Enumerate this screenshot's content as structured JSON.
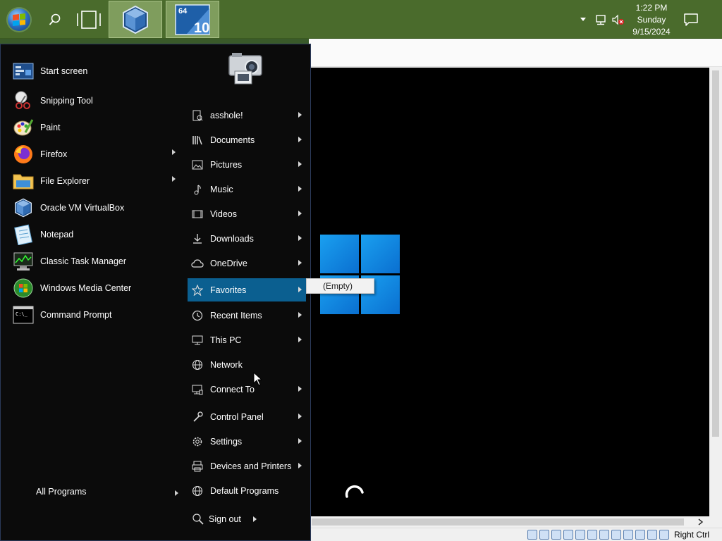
{
  "taskbar": {
    "clock": {
      "time": "1:22 PM",
      "day": "Sunday",
      "date": "9/15/2024"
    },
    "apps": [
      {
        "icon": "virtualbox-icon"
      },
      {
        "icon": "windows10-vm-icon",
        "badge_top": "64",
        "badge_num": "10"
      }
    ]
  },
  "start_menu": {
    "programs": [
      {
        "label": "Start screen",
        "icon": "start-screen-icon",
        "has_submenu": false
      },
      {
        "label": "Snipping Tool",
        "icon": "snipping-tool-icon",
        "has_submenu": false
      },
      {
        "label": "Paint",
        "icon": "paint-icon",
        "has_submenu": false
      },
      {
        "label": "Firefox",
        "icon": "firefox-icon",
        "has_submenu": true
      },
      {
        "label": "File Explorer",
        "icon": "file-explorer-icon",
        "has_submenu": true
      },
      {
        "label": "Oracle VM VirtualBox",
        "icon": "virtualbox-icon",
        "has_submenu": false
      },
      {
        "label": "Notepad",
        "icon": "notepad-icon",
        "has_submenu": false
      },
      {
        "label": "Classic Task Manager",
        "icon": "task-manager-icon",
        "has_submenu": false
      },
      {
        "label": "Windows Media Center",
        "icon": "media-center-icon",
        "has_submenu": false
      },
      {
        "label": "Command Prompt",
        "icon": "command-prompt-icon",
        "has_submenu": false
      }
    ],
    "all_programs": "All Programs",
    "places": [
      {
        "label": "asshole!",
        "icon": "user-folder-icon",
        "has_submenu": true
      },
      {
        "label": "Documents",
        "icon": "documents-icon",
        "has_submenu": true
      },
      {
        "label": "Pictures",
        "icon": "pictures-icon",
        "has_submenu": true
      },
      {
        "label": "Music",
        "icon": "music-icon",
        "has_submenu": true
      },
      {
        "label": "Videos",
        "icon": "videos-icon",
        "has_submenu": true
      },
      {
        "label": "Downloads",
        "icon": "downloads-icon",
        "has_submenu": true
      },
      {
        "label": "OneDrive",
        "icon": "onedrive-icon",
        "has_submenu": true
      },
      {
        "label": "Favorites",
        "icon": "favorites-icon",
        "has_submenu": true,
        "active": true
      },
      {
        "label": "Recent Items",
        "icon": "recent-items-icon",
        "has_submenu": true
      },
      {
        "label": "This PC",
        "icon": "this-pc-icon",
        "has_submenu": true
      },
      {
        "label": "Network",
        "icon": "network-icon",
        "has_submenu": false
      },
      {
        "label": "Connect To",
        "icon": "connect-to-icon",
        "has_submenu": true
      },
      {
        "label": "Control Panel",
        "icon": "control-panel-icon",
        "has_submenu": true
      },
      {
        "label": "Settings",
        "icon": "settings-icon",
        "has_submenu": true
      },
      {
        "label": "Devices and Printers",
        "icon": "devices-printers-icon",
        "has_submenu": true
      },
      {
        "label": "Default Programs",
        "icon": "default-programs-icon",
        "has_submenu": false
      }
    ],
    "sign_out": "Sign out",
    "flyout_text": "(Empty)"
  },
  "vm": {
    "host_key": "Right Ctrl"
  },
  "colors": {
    "taskbar": "#4a6b2c",
    "menu_bg": "#0b0b0b",
    "highlight": "#0b5f90",
    "win_blue": "#1aa0f0"
  }
}
